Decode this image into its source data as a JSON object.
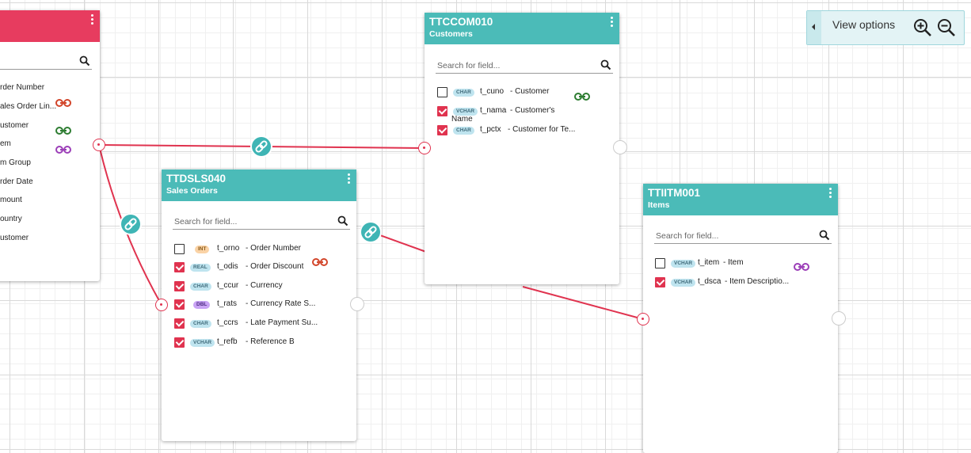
{
  "left_table": {
    "fields": [
      "rder Number",
      "ales Order Lin...",
      "ustomer",
      "em",
      "m Group",
      "rder Date",
      "mount",
      "ountry",
      "ustomer"
    ]
  },
  "customers_table": {
    "code": "TTCCOM010",
    "name": "Customers",
    "search_placeholder": "Search for field...",
    "fields": [
      {
        "type": "CHAR",
        "name": "t_cuno",
        "desc": "- Customer",
        "checked": false
      },
      {
        "type": "VCHAR",
        "name": "t_nama",
        "desc": "- Customer's",
        "desc2": "Name",
        "checked": true
      },
      {
        "type": "CHAR",
        "name": "t_pctx",
        "desc": "- Customer for Te...",
        "checked": true
      }
    ]
  },
  "sales_orders_table": {
    "code": "TTDSLS040",
    "name": "Sales Orders",
    "search_placeholder": "Search for field...",
    "fields": [
      {
        "type": "INT",
        "name": "t_orno",
        "desc": "- Order Number",
        "checked": false
      },
      {
        "type": "REAL",
        "name": "t_odis",
        "desc": "- Order Discount",
        "checked": true
      },
      {
        "type": "CHAR",
        "name": "t_ccur",
        "desc": "- Currency",
        "checked": true
      },
      {
        "type": "DBL",
        "name": "t_rats",
        "desc": "- Currency Rate S...",
        "checked": true
      },
      {
        "type": "CHAR",
        "name": "t_ccrs",
        "desc": "- Late Payment Su...",
        "checked": true
      },
      {
        "type": "VCHAR",
        "name": "t_refb",
        "desc": "- Reference B",
        "checked": true
      }
    ]
  },
  "items_table": {
    "code": "TTIITM001",
    "name": "Items",
    "search_placeholder": "Search for field...",
    "fields": [
      {
        "type": "VCHAR",
        "name": "t_item",
        "desc": "- Item",
        "checked": false
      },
      {
        "type": "VCHAR",
        "name": "t_dsca",
        "desc": "- Item Descriptio...",
        "checked": true
      }
    ]
  },
  "view_options": {
    "label": "View options"
  },
  "colors": {
    "teal_header": "#4bbbb8",
    "pink_header": "#e73c5f",
    "relation_line": "#e0334f",
    "link_orange": "#d2462b",
    "link_green": "#2e7d32",
    "link_purple": "#9c3fb8"
  }
}
